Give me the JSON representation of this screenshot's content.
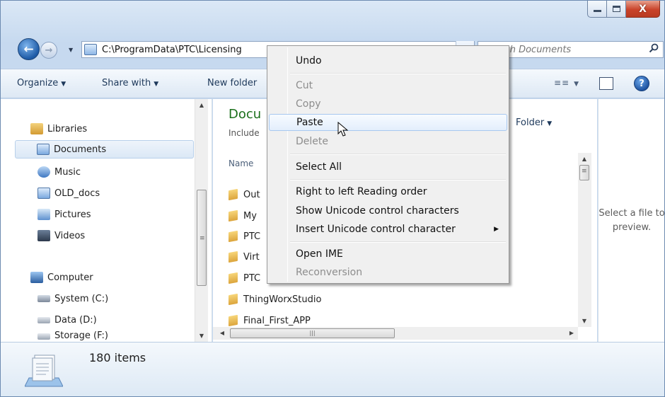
{
  "window": {
    "caption": {
      "minimize_glyph": "",
      "maximize_glyph": "",
      "close_glyph": "X"
    }
  },
  "address_bar": {
    "path": "C:\\ProgramData\\PTC\\Licensing",
    "search_placeholder": "Search Documents"
  },
  "toolbar": {
    "organize": "Organize",
    "share_with": "Share with",
    "new_folder": "New folder"
  },
  "nav_pane": {
    "items": [
      {
        "label": "Libraries"
      },
      {
        "label": "Documents"
      },
      {
        "label": "Music"
      },
      {
        "label": "OLD_docs"
      },
      {
        "label": "Pictures"
      },
      {
        "label": "Videos"
      },
      {
        "label": "Computer"
      },
      {
        "label": "System (C:)"
      },
      {
        "label": "Data (D:)"
      },
      {
        "label": "Storage (F:)"
      }
    ]
  },
  "content": {
    "library_title": "Docu",
    "library_subtitle": "Include",
    "arrange_by_value": "Folder",
    "column_name": "Name",
    "rows": [
      {
        "name": "Out"
      },
      {
        "name": "My"
      },
      {
        "name": "PTC"
      },
      {
        "name": "Virt"
      },
      {
        "name": "PTC"
      },
      {
        "name": "ThingWorxStudio"
      },
      {
        "name": "Final_First_APP"
      }
    ]
  },
  "preview_pane": {
    "text": "Select a file to preview."
  },
  "details_pane": {
    "item_count": "180 items"
  },
  "context_menu": {
    "items": [
      {
        "label": "Undo",
        "enabled": true
      },
      {
        "label": "Cut",
        "enabled": false
      },
      {
        "label": "Copy",
        "enabled": false
      },
      {
        "label": "Paste",
        "enabled": true,
        "highlighted": true
      },
      {
        "label": "Delete",
        "enabled": false
      },
      {
        "label": "Select All",
        "enabled": true
      },
      {
        "label": "Right to left Reading order",
        "enabled": true
      },
      {
        "label": "Show Unicode control characters",
        "enabled": true
      },
      {
        "label": "Insert Unicode control character",
        "enabled": true,
        "has_submenu": true
      },
      {
        "label": "Open IME",
        "enabled": true
      },
      {
        "label": "Reconversion",
        "enabled": false
      }
    ]
  },
  "colors": {
    "library_title": "#1b6f1b",
    "close_button": "#c9432a",
    "menu_highlight": "#e3eefc",
    "disabled_text": "#8d8d8d"
  }
}
